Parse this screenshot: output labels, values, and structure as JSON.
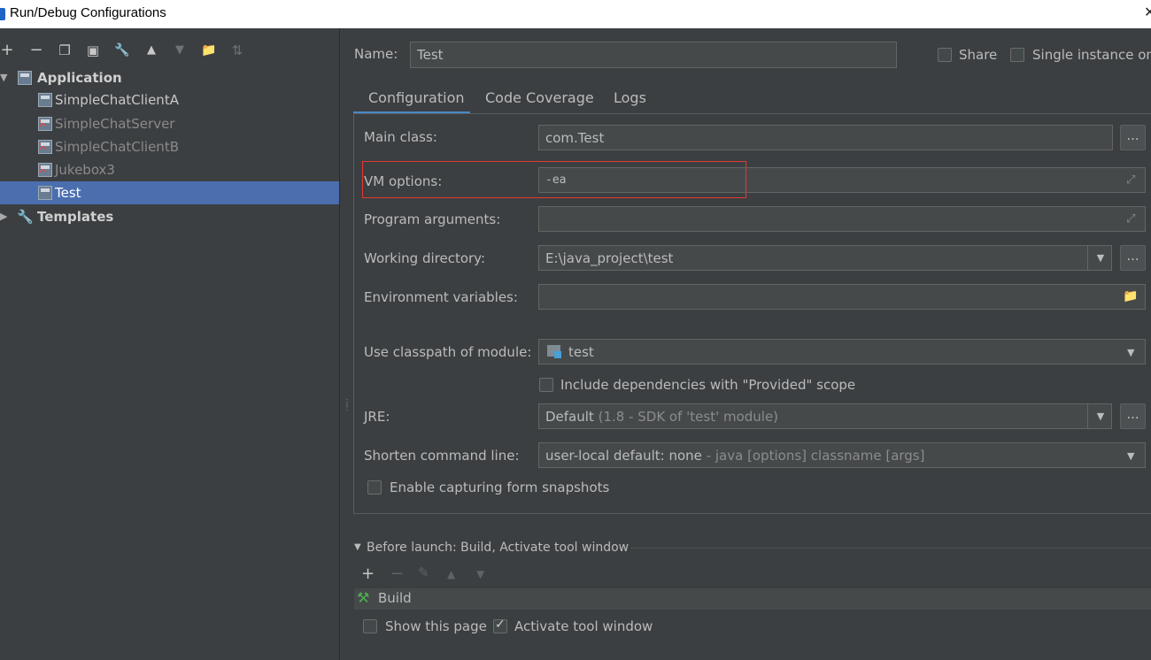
{
  "window": {
    "title": "Run/Debug Configurations",
    "close_glyph": "✕"
  },
  "toolbar": {
    "add": "+",
    "remove": "−",
    "copy": "❐",
    "save": "▣",
    "edit": "🔧",
    "up": "▲",
    "down": "▼",
    "folder": "📁",
    "sort": "⇅"
  },
  "tree": {
    "application": "Application",
    "items": [
      {
        "label": "SimpleChatClientA"
      },
      {
        "label": "SimpleChatServer"
      },
      {
        "label": "SimpleChatClientB"
      },
      {
        "label": "Jukebox3"
      },
      {
        "label": "Test"
      }
    ],
    "templates": "Templates"
  },
  "header": {
    "name_label": "Name:",
    "name_value": "Test",
    "share_label": "Share",
    "single_instance_label": "Single instance onl"
  },
  "tabs": [
    {
      "label": "Configuration"
    },
    {
      "label": "Code Coverage"
    },
    {
      "label": "Logs"
    }
  ],
  "form": {
    "main_class_label": "Main class:",
    "main_class_value": "com.Test",
    "vm_options_label": "VM options:",
    "vm_options_value": "-ea",
    "program_args_label": "Program arguments:",
    "working_dir_label": "Working directory:",
    "working_dir_value": "E:\\java_project\\test",
    "env_vars_label": "Environment variables:",
    "classpath_label": "Use classpath of module:",
    "classpath_value": "test",
    "include_deps_label": "Include dependencies with \"Provided\" scope",
    "jre_label": "JRE:",
    "jre_value_main": "Default",
    "jre_value_detail": "(1.8 - SDK of 'test' module)",
    "shorten_label": "Shorten command line:",
    "shorten_value_main": "user-local default: none",
    "shorten_value_detail": "- java [options] classname [args]",
    "snapshots_label": "Enable capturing form snapshots",
    "dots": "..."
  },
  "before_launch": {
    "title": "Before launch: Build, Activate tool window",
    "build_label": "Build",
    "show_page_label": "Show this page",
    "activate_label": "Activate tool window"
  }
}
